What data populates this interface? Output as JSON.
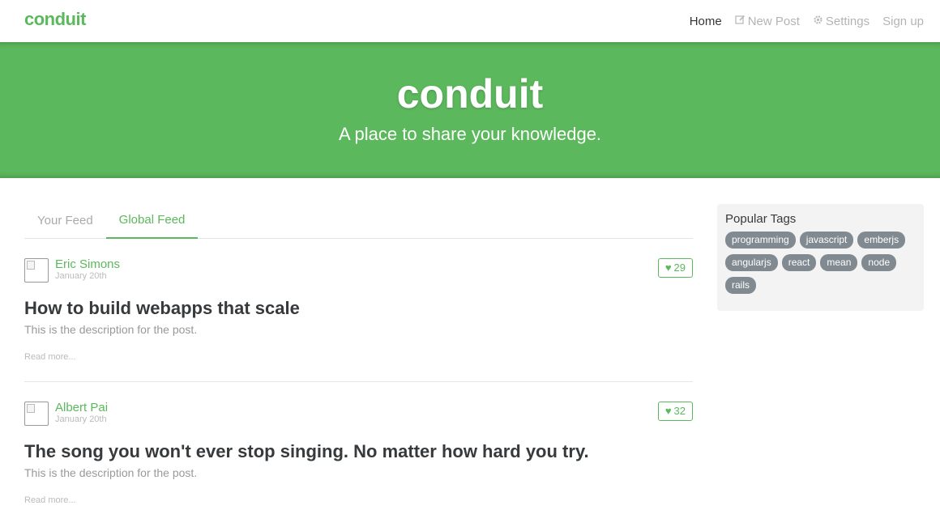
{
  "navbar": {
    "brand": "conduit",
    "items": [
      {
        "label": "Home",
        "icon": "",
        "active": true
      },
      {
        "label": "New Post",
        "icon": "compose-icon",
        "active": false
      },
      {
        "label": "Settings",
        "icon": "gear-icon",
        "active": false
      },
      {
        "label": "Sign up",
        "icon": "",
        "active": false
      }
    ]
  },
  "banner": {
    "title": "conduit",
    "subtitle": "A place to share your knowledge."
  },
  "feed": {
    "tabs": [
      {
        "label": "Your Feed",
        "active": false
      },
      {
        "label": "Global Feed",
        "active": true
      }
    ],
    "articles": [
      {
        "author": "Eric Simons",
        "date": "January 20th",
        "likes": "29",
        "title": "How to build webapps that scale",
        "description": "This is the description for the post.",
        "read_more": "Read more..."
      },
      {
        "author": "Albert Pai",
        "date": "January 20th",
        "likes": "32",
        "title": "The song you won't ever stop singing. No matter how hard you try.",
        "description": "This is the description for the post.",
        "read_more": "Read more..."
      }
    ]
  },
  "sidebar": {
    "title": "Popular Tags",
    "tags": [
      "programming",
      "javascript",
      "emberjs",
      "angularjs",
      "react",
      "mean",
      "node",
      "rails"
    ]
  },
  "colors": {
    "brand": "#5cb85c",
    "tag_bg": "#818a91",
    "sidebar_bg": "#f3f3f3"
  }
}
